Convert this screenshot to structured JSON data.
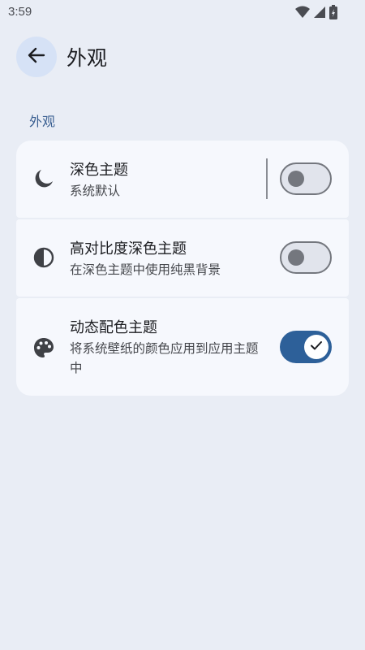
{
  "status_bar": {
    "time": "3:59"
  },
  "app_bar": {
    "title": "外观"
  },
  "section": {
    "header": "外观"
  },
  "settings": [
    {
      "title": "深色主题",
      "subtitle": "系统默认",
      "icon": "dark-mode-moon-icon",
      "toggle": false
    },
    {
      "title": "高对比度深色主题",
      "subtitle": "在深色主题中使用纯黑背景",
      "icon": "contrast-icon",
      "toggle": false
    },
    {
      "title": "动态配色主题",
      "subtitle": "将系统壁纸的颜色应用到应用主题中",
      "icon": "palette-icon",
      "toggle": true
    }
  ],
  "colors": {
    "accent": "#2d6099",
    "background": "#e9edf5",
    "card": "#f6f8fd",
    "section_header": "#3a5f91"
  }
}
